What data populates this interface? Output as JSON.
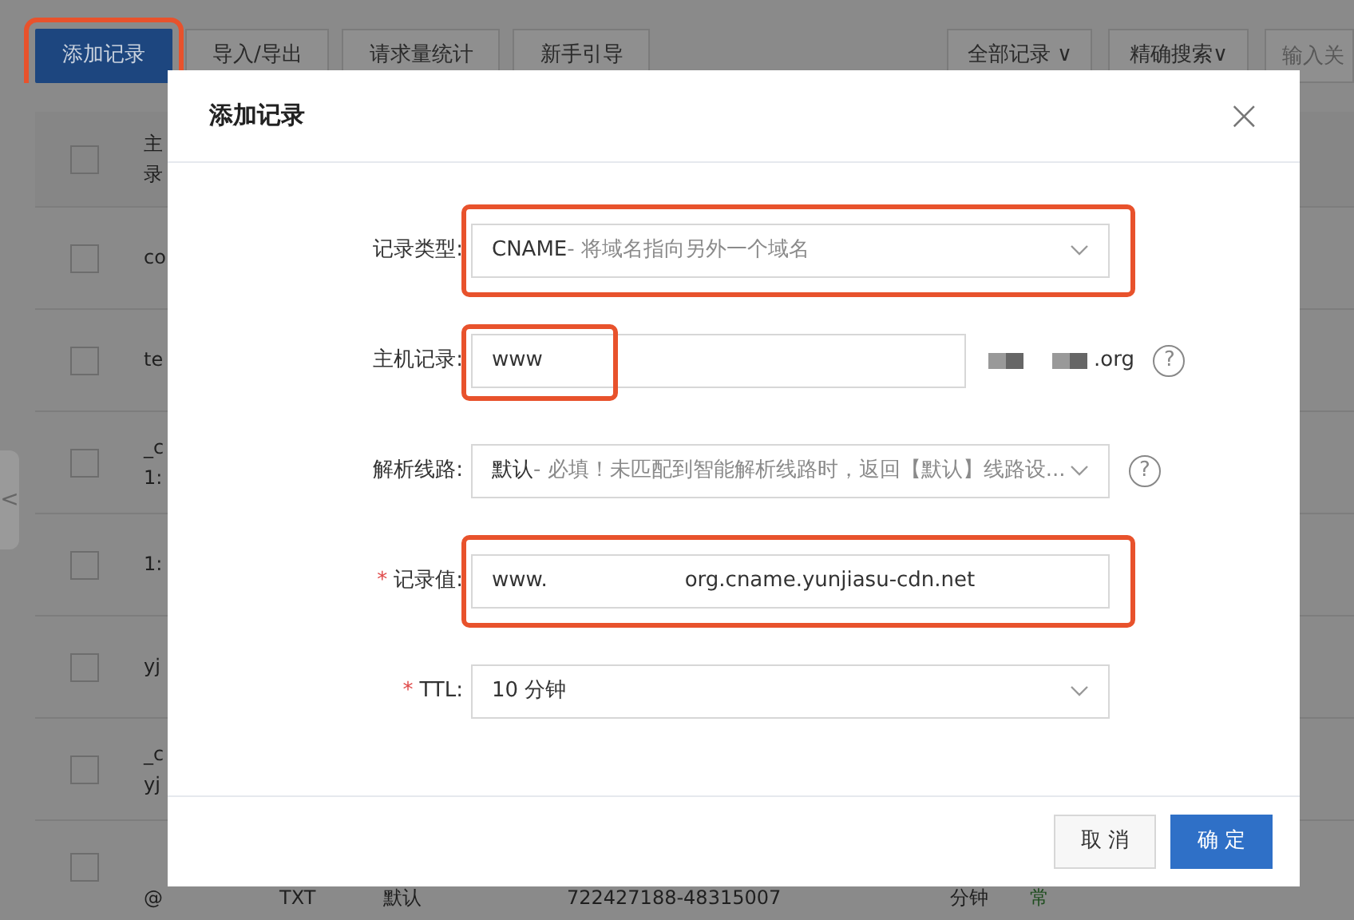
{
  "toolbar": {
    "buttons": [
      {
        "label": "添加记录",
        "kind": "primary",
        "highlighted": true
      },
      {
        "label": "导入/导出",
        "kind": "default"
      },
      {
        "label": "请求量统计",
        "kind": "default"
      },
      {
        "label": "新手引导",
        "kind": "default"
      }
    ],
    "filters": [
      {
        "label": "全部记录 ∨",
        "kind": "dropdown"
      },
      {
        "label": "精确搜索∨",
        "kind": "dropdown"
      },
      {
        "placeholder": "输入关",
        "kind": "search"
      }
    ]
  },
  "side_toggle": "<",
  "table": {
    "header": {
      "checked": false,
      "lines": [
        "主",
        "录"
      ]
    },
    "rows": [
      {
        "checked": false,
        "cells": [
          [
            "co"
          ]
        ]
      },
      {
        "checked": false,
        "cells": [
          [
            "te"
          ]
        ]
      },
      {
        "checked": false,
        "cells": [
          [
            "_c",
            "1:"
          ]
        ]
      },
      {
        "checked": false,
        "cells": [
          [
            "1:"
          ]
        ]
      },
      {
        "checked": false,
        "cells": [
          [
            "yj"
          ]
        ]
      },
      {
        "checked": false,
        "cells": [
          [
            "_c",
            "yj"
          ]
        ]
      },
      {
        "checked": false,
        "cells": [
          [
            "@"
          ],
          [
            "TXT"
          ],
          [
            "默认"
          ],
          [
            "722427188-48315007"
          ],
          [
            "分钟"
          ],
          [
            "常"
          ]
        ]
      }
    ]
  },
  "dialog": {
    "title": "添加记录",
    "close": "×",
    "fields": [
      {
        "label": "记录类型:",
        "kind": "select",
        "value": "CNAME",
        "hint": "- 将域名指向另外一个域名",
        "highlighted": true
      },
      {
        "label": "主机记录:",
        "kind": "host",
        "value": "www",
        "suffix": ".org",
        "help": "?",
        "highlighted": true
      },
      {
        "label": "解析线路:",
        "kind": "select",
        "value": "默认",
        "hint": " - 必填！未匹配到智能解析线路时，返回【默认】线路设...",
        "help": "?",
        "highlighted": false
      },
      {
        "label": "记录值:",
        "required_mark": "*",
        "kind": "text",
        "value": "www.",
        "value_end": "org.cname.yunjiasu-cdn.net",
        "highlighted": true
      },
      {
        "label": "TTL:",
        "required_mark": "*",
        "kind": "select",
        "value": "10 分钟",
        "highlighted": false
      }
    ],
    "buttons": [
      {
        "label": "取 消",
        "kind": "default"
      },
      {
        "label": "确 定",
        "kind": "primary"
      }
    ]
  }
}
